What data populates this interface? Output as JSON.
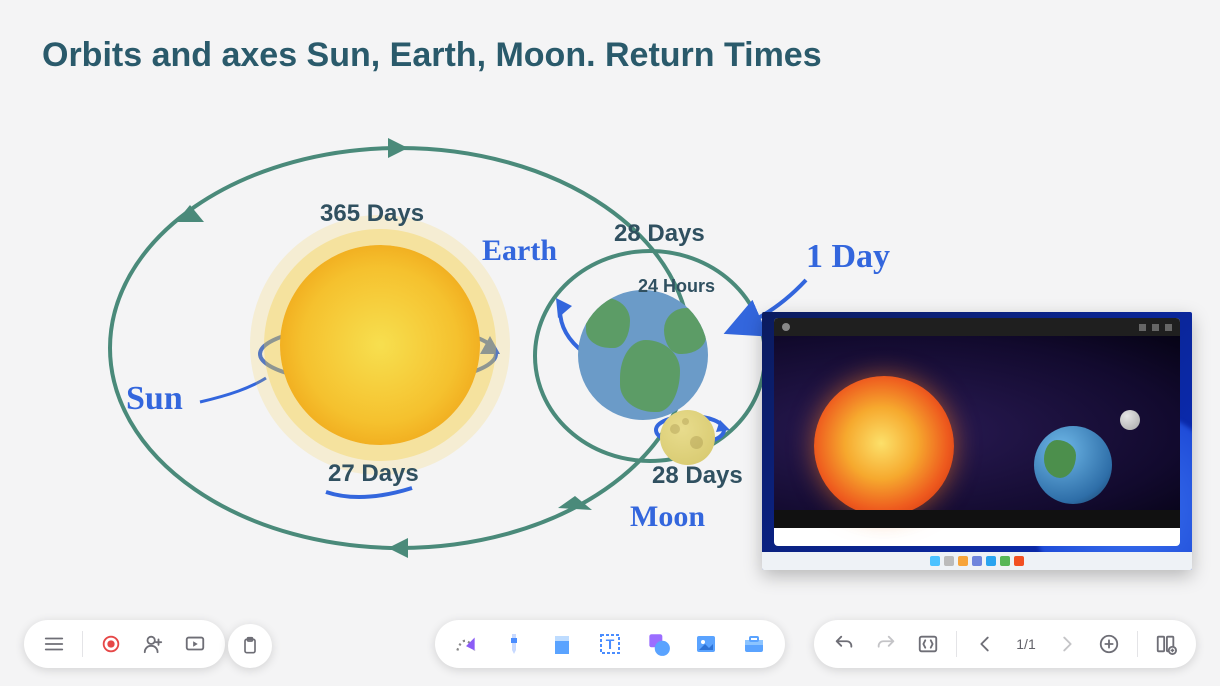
{
  "title": "Orbits and axes Sun, Earth, Moon. Return Times",
  "diagram": {
    "sun_period_label": "365 Days",
    "sun_axis_label": "27 Days",
    "earth_orbit_label": "28 Days",
    "earth_axis_label": "24 Hours",
    "moon_period_label": "28 Days",
    "sun_handwrite": "Sun",
    "earth_handwrite": "Earth",
    "moon_handwrite": "Moon",
    "one_day_handwrite": "1 Day"
  },
  "page_indicator": "1/1",
  "toolbars": {
    "left_items": [
      "menu",
      "record",
      "add-user",
      "present"
    ],
    "left_extra": "clipboard",
    "center_tools": [
      "spline",
      "pen",
      "rect",
      "text",
      "shapes",
      "image",
      "toolbox"
    ],
    "right_items": [
      "undo",
      "redo",
      "page-toggle",
      "prev",
      "page-indicator",
      "next",
      "add-page",
      "page-overview"
    ]
  },
  "thumbnail_taskbar_colors": [
    "#4cc2ff",
    "#f7630c",
    "#7f7fff",
    "#76b900",
    "#00a4ef",
    "#50d250",
    "#f25022"
  ]
}
